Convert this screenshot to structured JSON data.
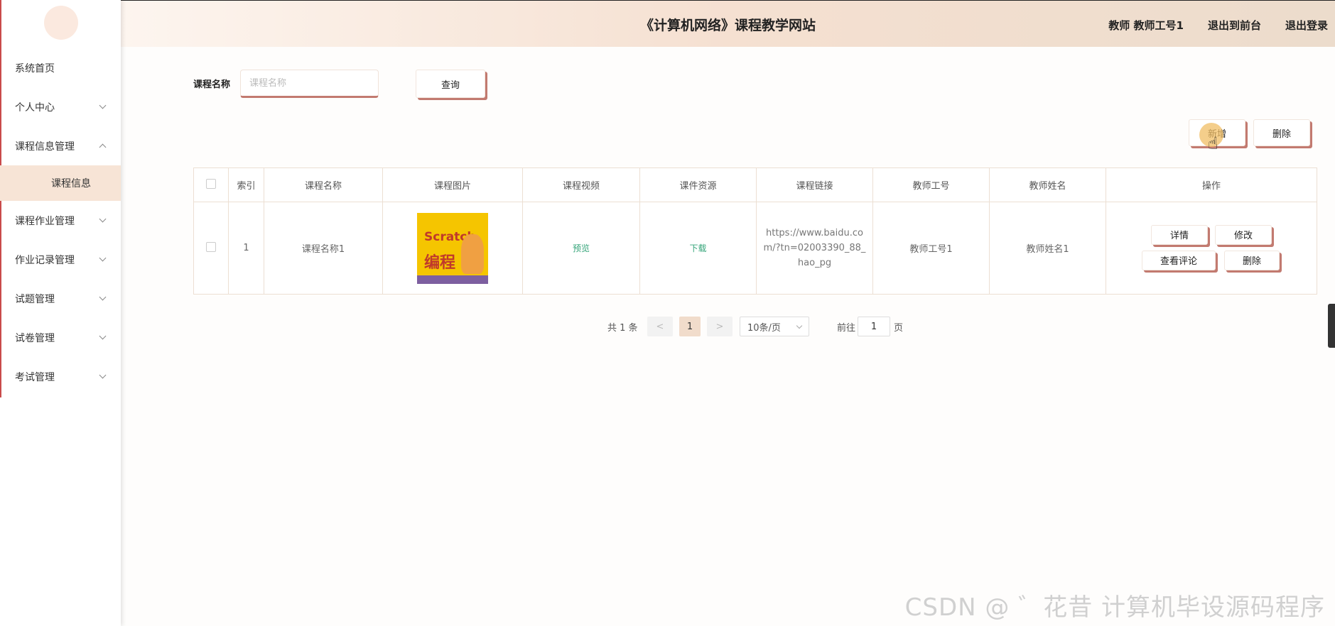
{
  "header": {
    "title": "《计算机网络》课程教学网站",
    "user": "教师 教师工号1",
    "back_front": "退出到前台",
    "logout": "退出登录"
  },
  "sidebar": {
    "items": [
      {
        "label": "系统首页"
      },
      {
        "label": "个人中心"
      },
      {
        "label": "课程信息管理"
      },
      {
        "label": "课程作业管理"
      },
      {
        "label": "作业记录管理"
      },
      {
        "label": "试题管理"
      },
      {
        "label": "试卷管理"
      },
      {
        "label": "考试管理"
      }
    ],
    "submenu": {
      "label": "课程信息"
    }
  },
  "search": {
    "label": "课程名称",
    "placeholder": "课程名称",
    "button": "查询"
  },
  "actions": {
    "add": "新增",
    "delete": "删除"
  },
  "table": {
    "headers": [
      "索引",
      "课程名称",
      "课程图片",
      "课程视频",
      "课件资源",
      "课程链接",
      "教师工号",
      "教师姓名",
      "操作"
    ],
    "rows": [
      {
        "index": "1",
        "name": "课程名称1",
        "image_text_1": "Scratch",
        "image_text_2": "编程",
        "video": "预览",
        "resource": "下载",
        "link": "https://www.baidu.com/?tn=02003390_88_hao_pg",
        "teacher_id": "教师工号1",
        "teacher_name": "教师姓名1",
        "ops": {
          "detail": "详情",
          "edit": "修改",
          "comments": "查看评论",
          "delete": "删除"
        }
      }
    ]
  },
  "pagination": {
    "total": "共 1 条",
    "prev": "<",
    "current": "1",
    "next": ">",
    "page_size": "10条/页",
    "goto_label": "前往",
    "goto_value": "1",
    "goto_suffix": "页"
  },
  "watermark": "CSDN @ ゛花昔 计算机毕设源码程序",
  "colors": {
    "accent_shadow": "#c27a70",
    "submenu_bg": "#f7e4d6",
    "link_green": "#36a57a"
  }
}
